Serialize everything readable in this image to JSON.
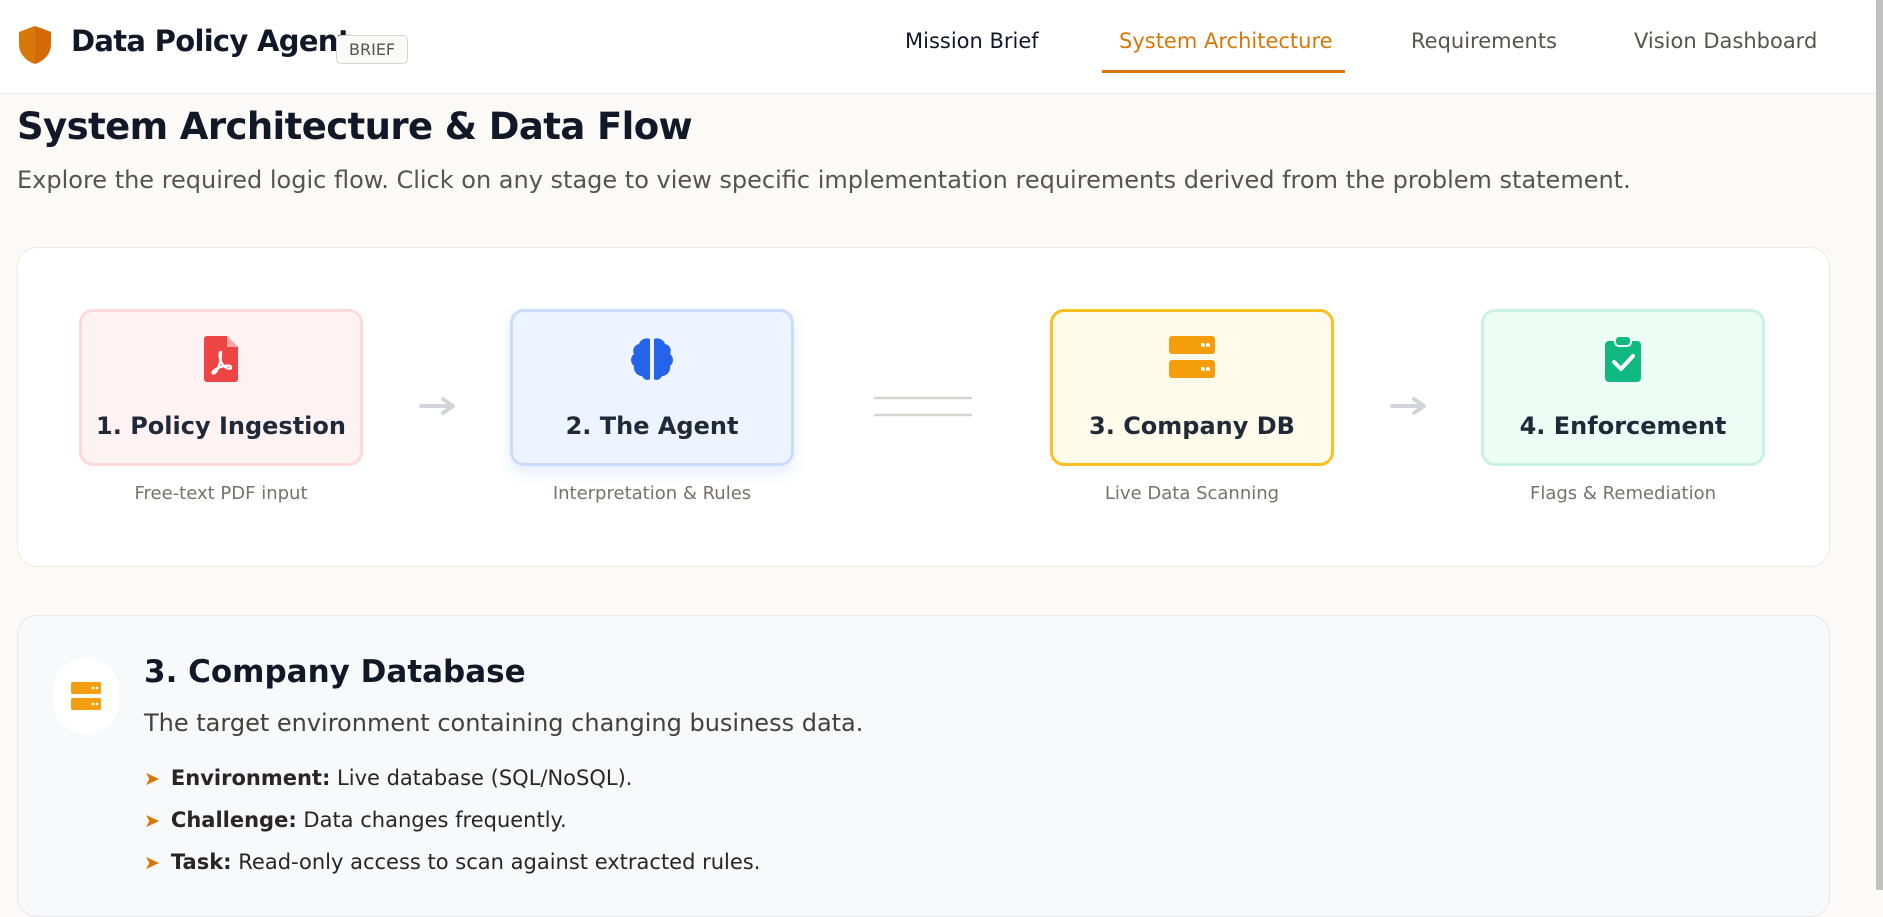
{
  "header": {
    "app_title": "Data Policy Agent",
    "badge": "BRIEF",
    "tabs": [
      {
        "label": "Mission Brief"
      },
      {
        "label": "System Architecture",
        "active": true
      },
      {
        "label": "Requirements"
      },
      {
        "label": "Vision Dashboard"
      }
    ]
  },
  "page": {
    "title": "System Architecture & Data Flow",
    "subtitle": "Explore the required logic flow. Click on any stage to view specific implementation requirements derived from the problem statement."
  },
  "flow": {
    "stages": [
      {
        "title": "1. Policy Ingestion",
        "caption": "Free-text PDF input",
        "icon": "pdf-file-icon",
        "color": "#ef4444"
      },
      {
        "title": "2. The Agent",
        "caption": "Interpretation & Rules",
        "icon": "brain-icon",
        "color": "#2563eb"
      },
      {
        "title": "3. Company DB",
        "caption": "Live Data Scanning",
        "icon": "database-server-icon",
        "color": "#f59e0b",
        "selected": true
      },
      {
        "title": "4. Enforcement",
        "caption": "Flags & Remediation",
        "icon": "clipboard-check-icon",
        "color": "#10b981"
      }
    ]
  },
  "detail": {
    "title": "3. Company Database",
    "description": "The target environment containing changing business data.",
    "icon": "database-server-icon",
    "items": [
      {
        "label": "Environment:",
        "text": "Live database (SQL/NoSQL)."
      },
      {
        "label": "Challenge:",
        "text": "Data changes frequently."
      },
      {
        "label": "Task:",
        "text": "Read-only access to scan against extracted rules."
      }
    ]
  },
  "colors": {
    "accent": "#d97706",
    "brand_shield": "#d97706"
  }
}
